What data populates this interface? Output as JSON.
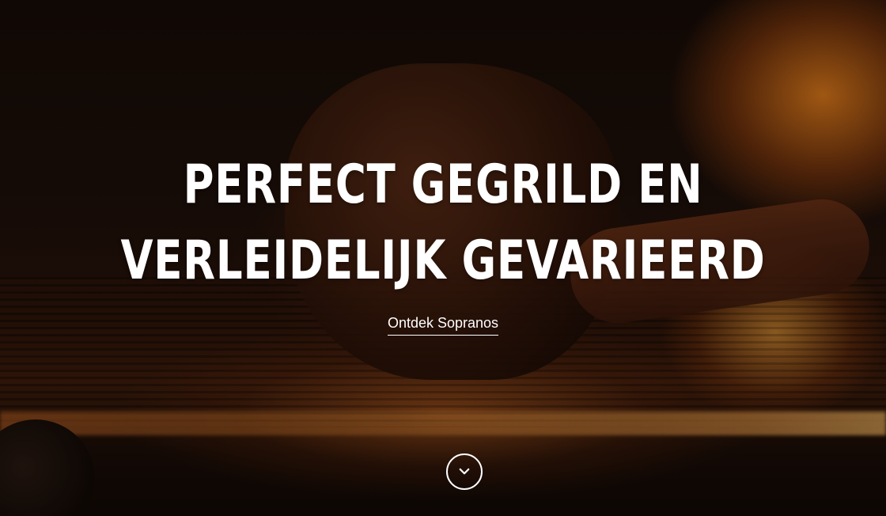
{
  "hero": {
    "title_line1": "PERFECT GEGRILD EN",
    "title_line2": "VERLEIDELIJK GEVARIEERD",
    "cta_label": "Ontdek Sopranos",
    "scroll_icon": "chevron-down-icon",
    "text_color": "#ffffff"
  }
}
